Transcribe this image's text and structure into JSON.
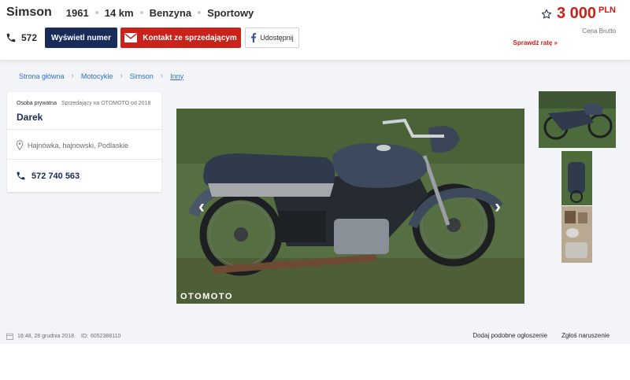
{
  "header": {
    "title": "Simson",
    "params": [
      "1961",
      "14 km",
      "Benzyna",
      "Sportowy"
    ],
    "phone_short": "572",
    "show_number_label": "Wyświetl numer",
    "contact_label": "Kontakt ze sprzedającym",
    "share_label": "Udostępnij",
    "price": "3 000",
    "currency": "PLN",
    "price_note": "Cena Brutto",
    "rate_link": "Sprawdź ratę »"
  },
  "breadcrumb": [
    "Strona główna",
    "Motocykle",
    "Simson",
    "Inny"
  ],
  "seller": {
    "type": "Osoba prywatna",
    "since": "Sprzedający na OTOMOTO od 2018",
    "name": "Darek",
    "location": "Hajnówka, hajnowski, Podlaskie",
    "phone": "572 740 563"
  },
  "gallery": {
    "watermark": "OTOMOTO",
    "prev_icon": "chevron-left-icon",
    "next_icon": "chevron-right-icon"
  },
  "meta": {
    "date": "16:48, 28 grudnia 2018",
    "id_label": "ID:",
    "id_value": "6052388110"
  },
  "footer_links": {
    "add_similar": "Dodaj podobne ogłoszenie",
    "report": "Zgłoś naruszenie"
  },
  "colors": {
    "accent_red": "#c8221a",
    "navy": "#182b59",
    "link_blue": "#2e6fc6",
    "page_bg": "#f3f4f7"
  }
}
